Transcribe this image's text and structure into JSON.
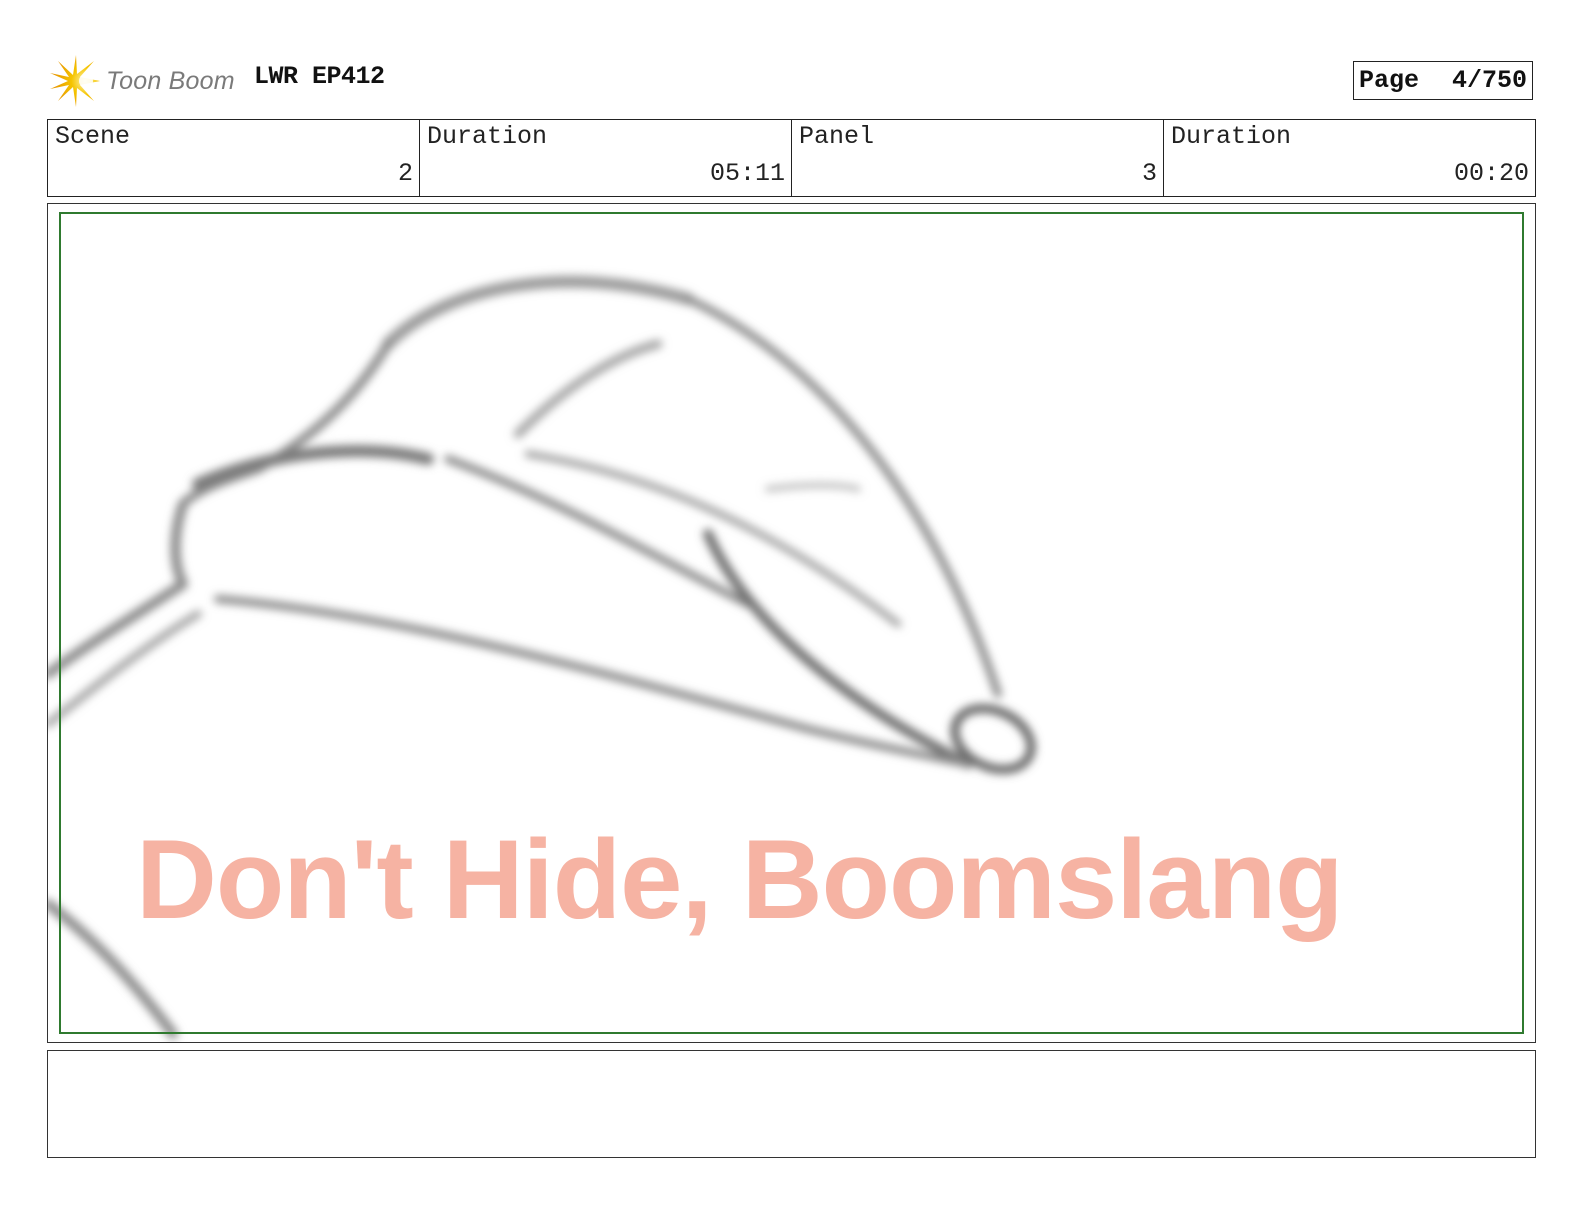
{
  "header": {
    "logo_text": "Toon Boom",
    "project_title": "LWR EP412",
    "page_label": "Page",
    "page_value": "4/750"
  },
  "info": {
    "scene_label": "Scene",
    "scene_value": "2",
    "scene_duration_label": "Duration",
    "scene_duration_value": "05:11",
    "panel_label": "Panel",
    "panel_value": "3",
    "panel_duration_label": "Duration",
    "panel_duration_value": "00:20"
  },
  "panel": {
    "watermark_text": "Don't Hide, Boomslang"
  },
  "notes": {
    "text": ""
  },
  "colors": {
    "safe_frame": "#2f7a2f",
    "watermark": "#f6b3a3",
    "logo_burst": "#f5c400"
  }
}
